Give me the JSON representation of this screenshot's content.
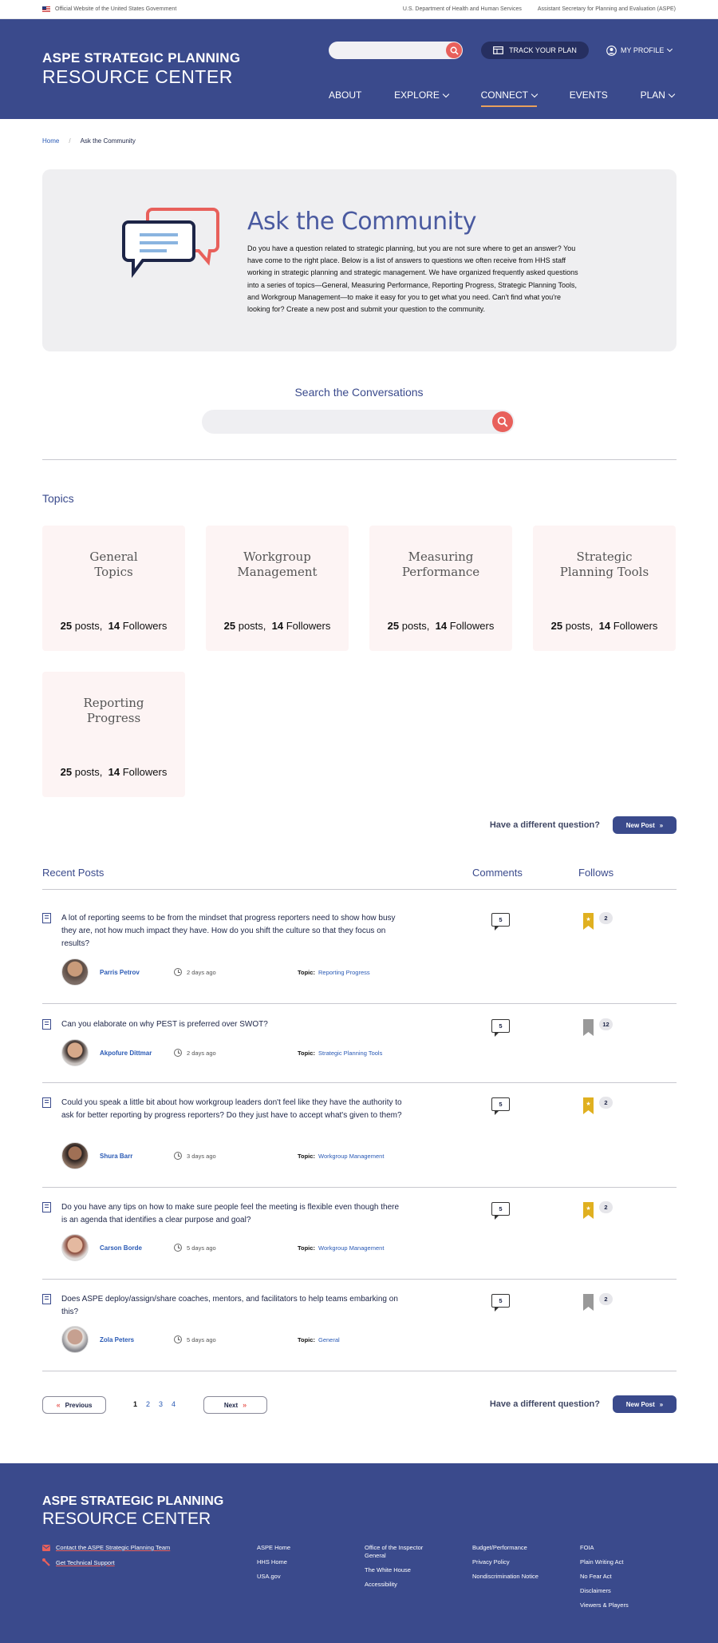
{
  "gov_bar": {
    "official": "Official Website of the United States Government",
    "hhs": "U.S. Department of Health and Human Services",
    "aspe": "Assistant Secretary for Planning and Evaluation (ASPE)"
  },
  "header": {
    "logo_line1": "ASPE STRATEGIC PLANNING",
    "logo_line2": "RESOURCE CENTER",
    "track_label": "TRACK YOUR PLAN",
    "profile_label": "MY PROFILE",
    "nav": [
      {
        "label": "ABOUT"
      },
      {
        "label": "EXPLORE"
      },
      {
        "label": "CONNECT"
      },
      {
        "label": "EVENTS"
      },
      {
        "label": "PLAN"
      }
    ]
  },
  "breadcrumb": {
    "home": "Home",
    "current": "Ask the Community"
  },
  "hero": {
    "title": "Ask the Community",
    "body": "Do you have a question related to strategic planning, but you are not sure where to get an answer? You have come to the right place.  Below is a list of answers to questions we often receive from HHS staff working in strategic planning and strategic management.  We have organized frequently asked questions into a series of topics—General, Measuring Performance, Reporting Progress, Strategic Planning Tools, and Workgroup Management—to make it easy for you to get what you need.  Can't find what you're looking for?  Create a new post and submit your question to the community."
  },
  "search": {
    "title": "Search the Conversations",
    "placeholder": ""
  },
  "topics": {
    "heading": "Topics",
    "posts_word": "posts,",
    "followers_word": "Followers",
    "items": [
      {
        "name": "General Topics",
        "posts": "25",
        "followers": "14"
      },
      {
        "name": "Workgroup Management",
        "posts": "25",
        "followers": "14"
      },
      {
        "name": "Measuring Performance",
        "posts": "25",
        "followers": "14"
      },
      {
        "name": "Strategic Planning Tools",
        "posts": "25",
        "followers": "14"
      },
      {
        "name": "Reporting Progress",
        "posts": "25",
        "followers": "14"
      }
    ]
  },
  "cta": {
    "question": "Have a different question?",
    "new_post": "New Post"
  },
  "recent": {
    "heading": "Recent Posts",
    "comments_col": "Comments",
    "follows_col": "Follows",
    "topic_label": "Topic:",
    "posts": [
      {
        "question": "A lot of reporting seems to be from the mindset that progress reporters need to show how busy they are, not how much impact they have.  How do you shift the culture so that they focus on results?",
        "author": "Parris Petrov",
        "time": "2 days ago",
        "topic": "Reporting Progress",
        "comments": "5",
        "follows": "2",
        "followed": true
      },
      {
        "question": "Can you elaborate on why PEST is preferred over SWOT?",
        "author": "Akpofure Dittmar",
        "time": "2 days ago",
        "topic": "Strategic Planning Tools",
        "comments": "5",
        "follows": "12",
        "followed": false
      },
      {
        "question": "Could you speak a little bit about how workgroup leaders don't feel like they have the authority to ask for better reporting by progress reporters?  Do they just have to accept what's given to them?",
        "author": "Shura Barr",
        "time": "3 days ago",
        "topic": "Workgroup Management",
        "comments": "5",
        "follows": "2",
        "followed": true
      },
      {
        "question": "Do you have any tips on how to make sure people feel the meeting is flexible even though there is an agenda that identifies a clear purpose and goal?",
        "author": "Carson Borde",
        "time": "5 days ago",
        "topic": "Workgroup Management",
        "comments": "5",
        "follows": "2",
        "followed": true
      },
      {
        "question": "Does ASPE deploy/assign/share coaches, mentors, and facilitators to help teams embarking on this?",
        "author": "Zola Peters",
        "time": "5 days ago",
        "topic": "General",
        "comments": "5",
        "follows": "2",
        "followed": false
      }
    ]
  },
  "pagination": {
    "previous": "Previous",
    "next": "Next",
    "pages": [
      "1",
      "2",
      "3",
      "4"
    ]
  },
  "footer": {
    "logo_line1": "ASPE STRATEGIC PLANNING",
    "logo_line2": "RESOURCE CENTER",
    "contact": "Contact the ASPE Strategic Planning Team",
    "support": "Get Technical Support",
    "col1": [
      "ASPE Home",
      "HHS Home",
      "USA.gov"
    ],
    "col2": [
      "Office of the Inspector General",
      "The White House",
      "Accessibility"
    ],
    "col3": [
      "Budget/Performance",
      "Privacy Policy",
      "Nondiscrimination Notice"
    ],
    "col4": [
      "FOIA",
      "Plain Writing Act",
      "No Fear Act",
      "Disclaimers",
      "Viewers & Players"
    ]
  },
  "colors": {
    "brand": "#3a4a8c",
    "accent": "#e8605b",
    "bookmark_active": "#e0b020",
    "bookmark_inactive": "#999999"
  }
}
